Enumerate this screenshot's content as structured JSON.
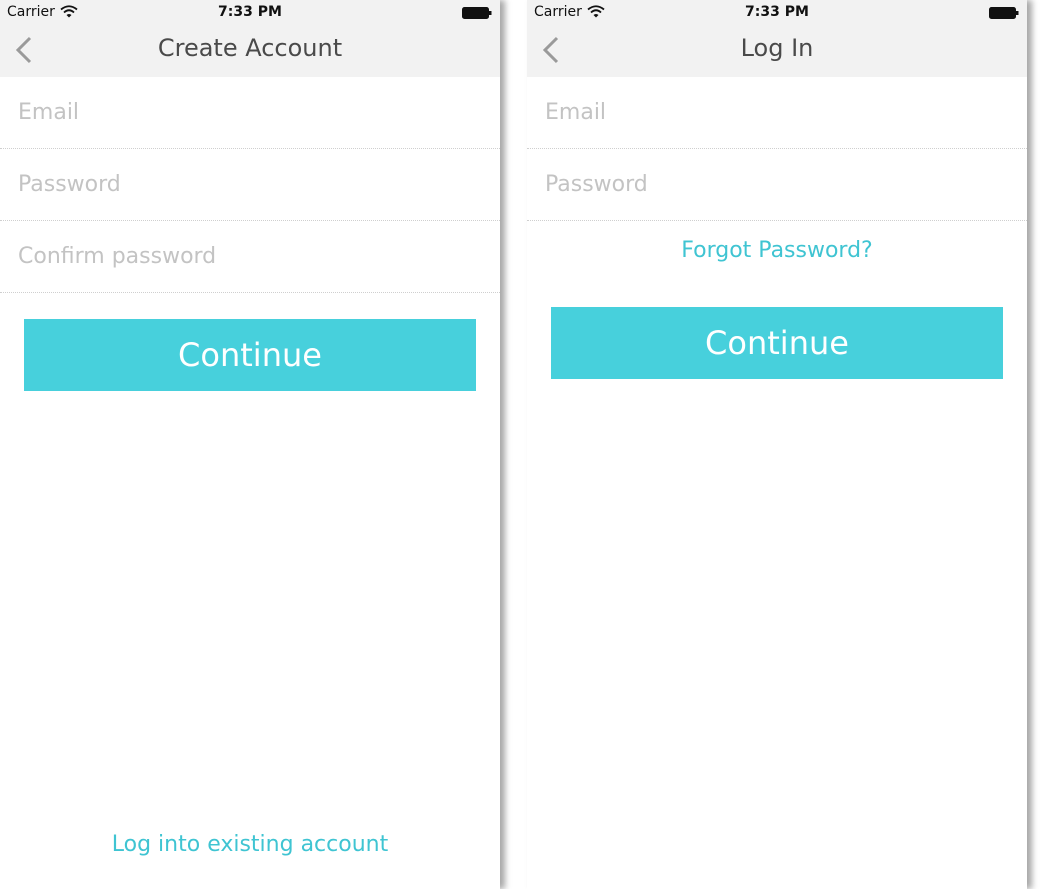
{
  "colors": {
    "accent": "#47d0dc",
    "link": "#3fc4d2",
    "navbar_bg": "#f2f2f2",
    "placeholder": "#c3c3c3",
    "title": "#4a4a4a"
  },
  "screens": {
    "create_account": {
      "status": {
        "carrier": "Carrier",
        "time": "7:33 PM"
      },
      "nav": {
        "title": "Create Account",
        "back_icon": "chevron-left-icon"
      },
      "fields": {
        "email_placeholder": "Email",
        "password_placeholder": "Password",
        "confirm_placeholder": "Confirm password"
      },
      "continue_label": "Continue",
      "login_link": "Log into existing account"
    },
    "log_in": {
      "status": {
        "carrier": "Carrier",
        "time": "7:33 PM"
      },
      "nav": {
        "title": "Log In",
        "back_icon": "chevron-left-icon"
      },
      "fields": {
        "email_placeholder": "Email",
        "password_placeholder": "Password"
      },
      "forgot_link": "Forgot Password?",
      "continue_label": "Continue"
    }
  }
}
